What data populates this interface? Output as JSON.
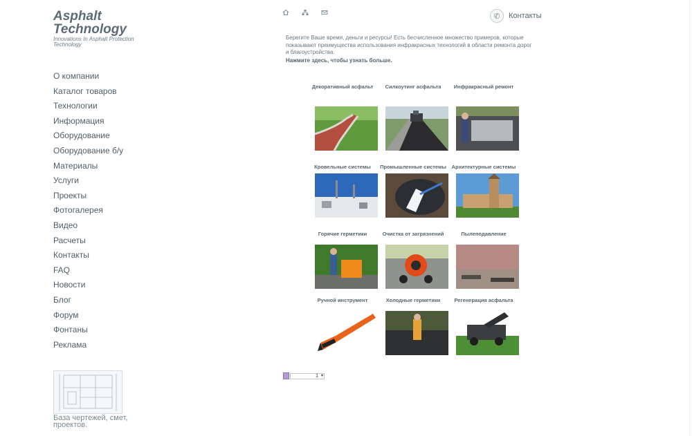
{
  "logo": {
    "line1": "Asphalt",
    "line2": "Technology",
    "tagline": "Innovations In Asphalt Protection Technology"
  },
  "nav": [
    "О компании",
    "Каталог товаров",
    "Технологии",
    "Информация",
    "Оборудование",
    "Оборудование б/у",
    "Материалы",
    "Услуги",
    "Проекты",
    "Фотогалерея",
    "Видео",
    "Расчеты",
    "Контакты",
    "FAQ",
    "Новости",
    "Блог",
    "Форум",
    "Фонтаны",
    "Реклама"
  ],
  "promo": {
    "caption": "База чертежей, смет, проектов."
  },
  "top_icons": [
    "home-icon",
    "sitemap-icon",
    "mail-icon"
  ],
  "contacts": {
    "label": "Контакты",
    "icon": "phone-icon"
  },
  "intro": {
    "text": "Берегите Ваше время, деньги и ресурсы! Есть бесчисленное множество примеров, которые показывают преимущества использования инфракрасных технологий в области ремонта дорог и благоустройства.",
    "link": "Нажмите здесь, чтобы узнать больше."
  },
  "gallery": [
    {
      "caption": "Декоративный асфальт"
    },
    {
      "caption": "Силкоутинг асфальта"
    },
    {
      "caption": "Инфракрасный ремонт"
    },
    {
      "caption": "Кровельные системы"
    },
    {
      "caption": "Промышленные системы"
    },
    {
      "caption": "Архитектурные системы"
    },
    {
      "caption": "Горячие герметики"
    },
    {
      "caption": "Очистка от загрязнений"
    },
    {
      "caption": "Пылеподавление"
    },
    {
      "caption": "Ручной инструмент"
    },
    {
      "caption": "Холодные герметики"
    },
    {
      "caption": "Регенерация асфальта"
    }
  ],
  "pager": {
    "value": "1"
  },
  "colors": {
    "text": "#4a5a64",
    "logo": "#5a6b75",
    "accent": "#b39bd6"
  }
}
